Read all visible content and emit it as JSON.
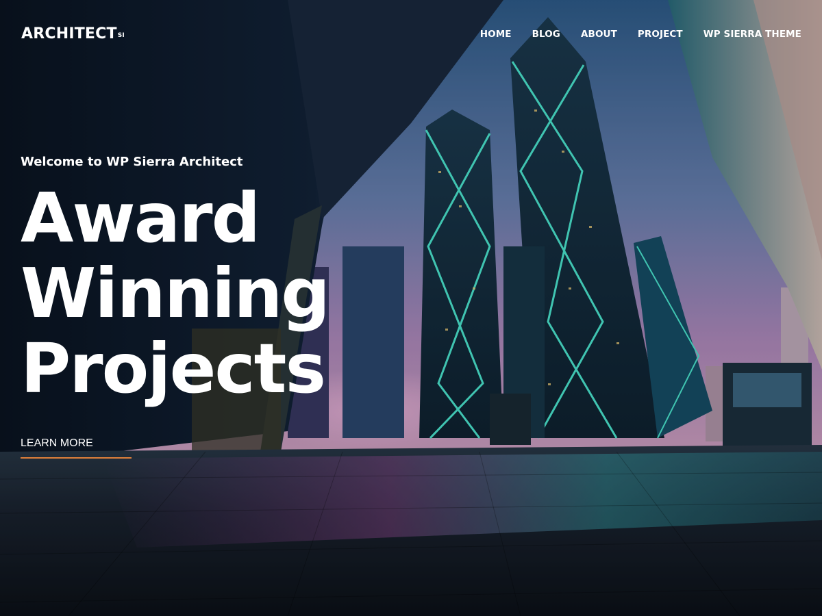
{
  "header": {
    "logo": {
      "text": "ARCHITECT",
      "superscript": "SI"
    },
    "nav": [
      {
        "label": "HOME"
      },
      {
        "label": "BLOG"
      },
      {
        "label": "ABOUT"
      },
      {
        "label": "PROJECT"
      },
      {
        "label": "WP SIERRA THEME"
      }
    ]
  },
  "hero": {
    "welcome": "Welcome to WP Sierra Architect",
    "headline": [
      "Award",
      "Winning",
      "Projects"
    ],
    "cta_label": "LEARN MORE",
    "background_image": "night-city-skyscrapers-photo"
  },
  "colors": {
    "text": "#ffffff",
    "cta_underline": "#e0803a",
    "sky_top": "#3f6f9e",
    "sky_bottom": "#b88bc0",
    "tower_glow": "#4ff0d8"
  }
}
